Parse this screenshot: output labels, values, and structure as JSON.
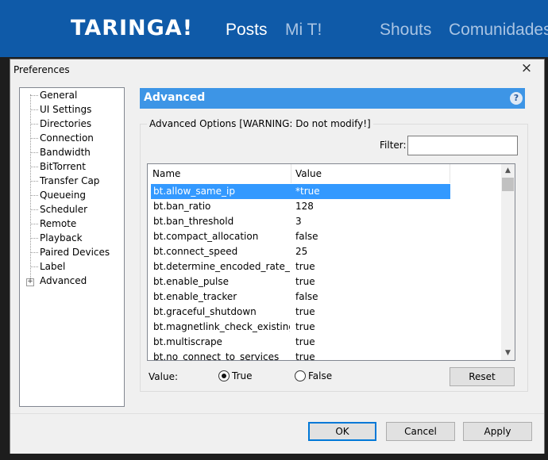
{
  "site": {
    "logo": "TARINGA!",
    "nav": [
      "Posts",
      "Mi T!",
      "Shouts",
      "Comunidades"
    ]
  },
  "dialog": {
    "title": "Preferences",
    "close": "×"
  },
  "tree": {
    "items": [
      "General",
      "UI Settings",
      "Directories",
      "Connection",
      "Bandwidth",
      "BitTorrent",
      "Transfer Cap",
      "Queueing",
      "Scheduler",
      "Remote",
      "Playback",
      "Paired Devices",
      "Label",
      "Advanced"
    ],
    "expander": "+"
  },
  "panel": {
    "title": "Advanced",
    "help": "?",
    "group_title": "Advanced Options [WARNING: Do not modify!]",
    "filter_label": "Filter:",
    "filter_value": ""
  },
  "table": {
    "columns": [
      "Name",
      "Value"
    ],
    "rows": [
      {
        "name": "bt.allow_same_ip",
        "value": "*true"
      },
      {
        "name": "bt.ban_ratio",
        "value": "128"
      },
      {
        "name": "bt.ban_threshold",
        "value": "3"
      },
      {
        "name": "bt.compact_allocation",
        "value": "false"
      },
      {
        "name": "bt.connect_speed",
        "value": "25"
      },
      {
        "name": "bt.determine_encoded_rate_fo...",
        "value": "true"
      },
      {
        "name": "bt.enable_pulse",
        "value": "true"
      },
      {
        "name": "bt.enable_tracker",
        "value": "false"
      },
      {
        "name": "bt.graceful_shutdown",
        "value": "true"
      },
      {
        "name": "bt.magnetlink_check_existing_...",
        "value": "true"
      },
      {
        "name": "bt.multiscrape",
        "value": "true"
      },
      {
        "name": "bt.no_connect_to_services",
        "value": "true"
      }
    ]
  },
  "value_editor": {
    "label": "Value:",
    "true_label": "True",
    "false_label": "False",
    "selected": "True",
    "reset_label": "Reset"
  },
  "buttons": {
    "ok": "OK",
    "cancel": "Cancel",
    "apply": "Apply"
  },
  "colors": {
    "header_bg": "#0f5aa8",
    "panel_head": "#3d95e6",
    "selection": "#3399ff"
  }
}
